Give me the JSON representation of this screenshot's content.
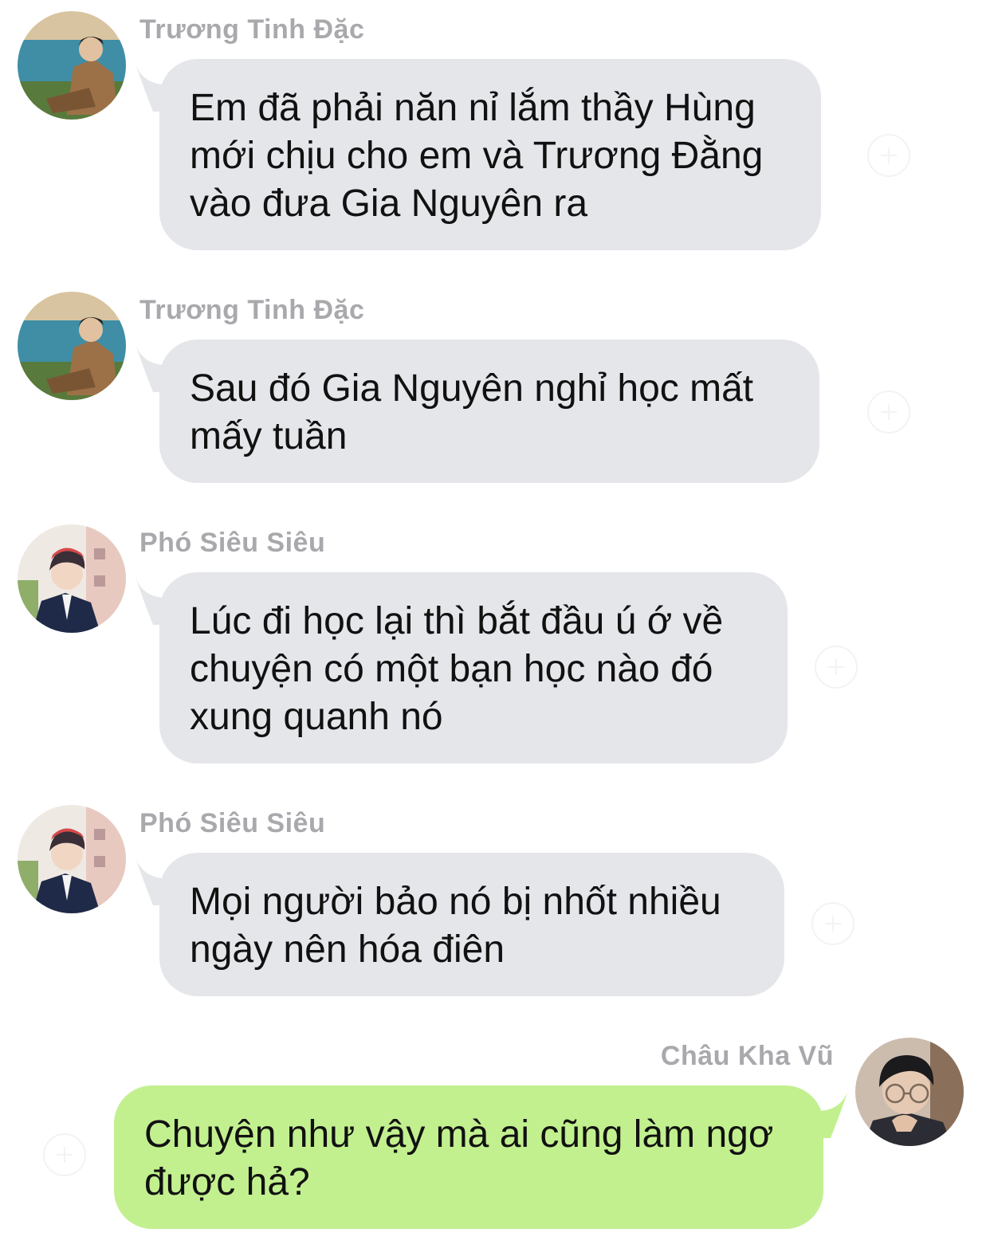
{
  "messages": [
    {
      "sender": "Trương Tinh Đặc",
      "text": "Em đã phải năn nỉ lắm thầy Hùng\nmới chịu cho em và Trương Đằng\nvào đưa Gia Nguyên ra",
      "direction": "incoming",
      "avatar": "landscape-boy-avatar"
    },
    {
      "sender": "Trương Tinh Đặc",
      "text": "Sau đó Gia Nguyên nghỉ học mất\nmấy tuần",
      "direction": "incoming",
      "avatar": "landscape-boy-avatar"
    },
    {
      "sender": "Phó Siêu Siêu",
      "text": "Lúc đi học lại thì bắt đầu ú ớ về\nchuyện có một bạn học nào đó\nxung quanh nó",
      "direction": "incoming",
      "avatar": "cap-boy-avatar"
    },
    {
      "sender": "Phó Siêu Siêu",
      "text": "Mọi người bảo nó bị nhốt nhiều\nngày nên hóa điên",
      "direction": "incoming",
      "avatar": "cap-boy-avatar"
    },
    {
      "sender": "Châu Kha Vũ",
      "text": "Chuyện như vậy mà ai cũng làm ngơ\nđược hả?",
      "direction": "outgoing",
      "avatar": "glasses-boy-avatar"
    }
  ],
  "colors": {
    "incoming_bubble": "#e5e6ea",
    "outgoing_bubble": "#c2f08f",
    "sender_name": "#a9a9ad",
    "message_text": "#111111"
  }
}
